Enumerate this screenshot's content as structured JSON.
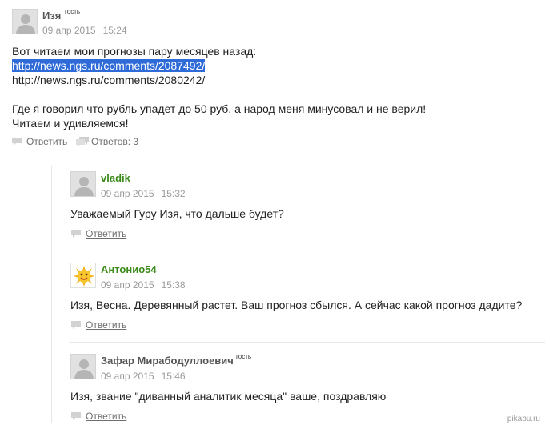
{
  "main_comment": {
    "author": "Изя",
    "guest_tag": "гость",
    "date": "09 апр 2015",
    "time": "15:24",
    "lines": [
      "Вот читаем мои прогнозы пару месяцев назад:",
      "http://news.ngs.ru/comments/2087492/",
      "http://news.ngs.ru/comments/2080242/",
      "",
      "Где я говорил что рубль упадет до 50 руб, а народ меня минусовал и не верил!",
      "Читаем и удивляемся!"
    ],
    "reply_label": "Ответить",
    "replies_label": "Ответов: 3"
  },
  "replies": [
    {
      "author": "vladik",
      "date": "09 апр 2015",
      "time": "15:32",
      "text": "Уважаемый Гуру Изя, что дальше будет?",
      "reply_label": "Ответить"
    },
    {
      "author": "Антонио54",
      "date": "09 апр 2015",
      "time": "15:38",
      "text": "Изя, Весна. Деревянный растет. Ваш прогноз сбылся. А сейчас какой прогноз дадите?",
      "reply_label": "Ответить"
    },
    {
      "author": "Зафар Мирабодуллоевич",
      "guest_tag": "гость",
      "date": "09 апр 2015",
      "time": "15:46",
      "text": "Изя, звание \"диванный аналитик месяца\" ваше, поздравляю",
      "reply_label": "Ответить"
    }
  ],
  "watermark": "pikabu.ru",
  "colors": {
    "user_name": "#3a8a1a",
    "guest_name": "#555555",
    "meta": "#9a9a9a",
    "link_selection": "#2f6bd8"
  }
}
